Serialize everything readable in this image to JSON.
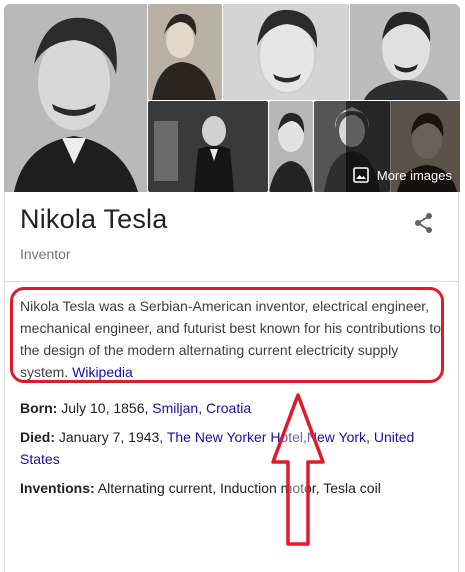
{
  "panel": {
    "title": "Nikola Tesla",
    "subtitle": "Inventor",
    "more_images_label": "More images",
    "description": "Nikola Tesla was a Serbian-American inventor, electrical engineer, mechanical engineer, and futurist best known for his contributions to the design of the modern alternating current electricity supply system.",
    "source_link": "Wikipedia"
  },
  "facts": {
    "born": {
      "label": "Born:",
      "text": "July 10, 1856,",
      "link1": "Smiljan",
      "sep": ",",
      "link2": "Croatia"
    },
    "died": {
      "label": "Died:",
      "text": "January 7, 1943,",
      "link1": "The New Yorker Hotel",
      "sep1": ",",
      "link2": "New York",
      "sep2": ",",
      "link3": "United States"
    },
    "inventions": {
      "label": "Inventions:",
      "text": "Alternating current, Induction motor, Tesla coil"
    }
  },
  "annotation": {
    "highlight_color": "#e01a2a",
    "arrow_color": "#e01a2a"
  },
  "colors": {
    "link": "#1a0dab",
    "text": "#202124",
    "muted": "#70757a"
  }
}
